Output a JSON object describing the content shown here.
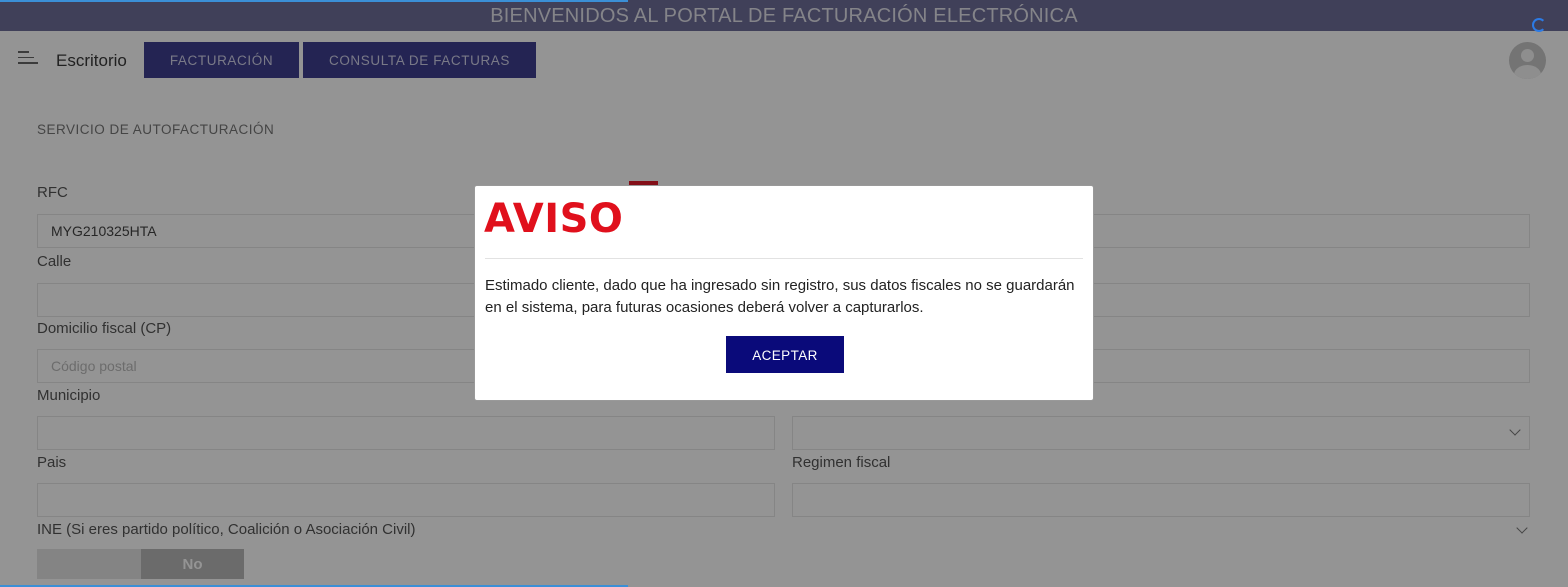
{
  "banner": {
    "title": "BIENVENIDOS AL PORTAL DE FACTURACIÓN ELECTRÓNICA"
  },
  "header": {
    "desk_label": "Escritorio",
    "nav": [
      {
        "label": "FACTURACIÓN"
      },
      {
        "label": "CONSULTA DE FACTURAS"
      }
    ]
  },
  "form": {
    "section_title": "SERVICIO DE AUTOFACTURACIÓN",
    "rfc": {
      "label": "RFC",
      "value": "MYG210325HTA"
    },
    "calle": {
      "label": "Calle",
      "value": ""
    },
    "cp": {
      "label": "Domicilio fiscal (CP)",
      "placeholder": "Código postal"
    },
    "municipio": {
      "label": "Municipio",
      "value": ""
    },
    "pais": {
      "label": "Pais",
      "value": ""
    },
    "regimen": {
      "label": "Regimen fiscal",
      "value": ""
    },
    "ine": {
      "label": "INE (Si eres partido político, Coalición o Asociación Civil)",
      "toggle_value": "No"
    }
  },
  "modal": {
    "title": "AVISO",
    "message": "Estimado cliente, dado que ha ingresado sin registro, sus datos fiscales no se guardarán en el sistema, para futuras ocasiones deberá volver a capturarlos.",
    "button": "ACEPTAR"
  },
  "colors": {
    "banner": "#6f6e9a",
    "nav_button": "#3f3f8f",
    "modal_title": "#e0101c",
    "accept_button": "#0a0a7a",
    "loading_bar": "#3b8fd6"
  }
}
